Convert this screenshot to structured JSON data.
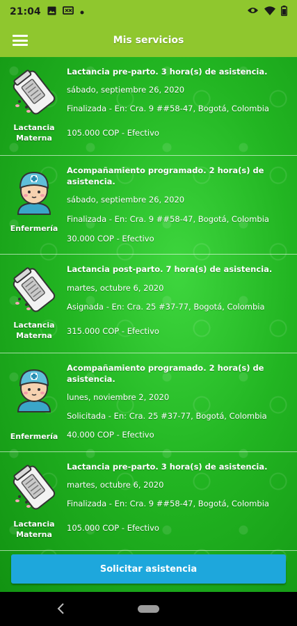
{
  "status_bar": {
    "time": "21:04",
    "left_icons": [
      "image-icon",
      "cast-icon",
      "dot-icon"
    ],
    "right_icons": [
      "eye-icon",
      "wifi-icon",
      "battery-icon"
    ]
  },
  "app_bar": {
    "title": "Mis servicios",
    "menu_icon": "menu-icon"
  },
  "services": [
    {
      "category": "Lactancia Materna",
      "icon": "breast-pump-icon",
      "service": "Lactancia pre-parto. 3 hora(s) de asistencia.",
      "date": "sábado, septiembre 26, 2020",
      "status_address": "Finalizada - En: Cra. 9 ##58-47, Bogotá, Colombia",
      "price_payment": "105.000 COP  - Efectivo"
    },
    {
      "category": "Enfermería",
      "icon": "nurse-icon",
      "service": "Acompañamiento programado. 2 hora(s) de asistencia.",
      "date": "sábado, septiembre 26, 2020",
      "status_address": "Finalizada - En: Cra. 9 ##58-47, Bogotá, Colombia",
      "price_payment": "30.000 COP  - Efectivo"
    },
    {
      "category": "Lactancia Materna",
      "icon": "breast-pump-icon",
      "service": "Lactancia post-parto. 7 hora(s) de asistencia.",
      "date": "martes, octubre 6, 2020",
      "status_address": "Asignada - En: Cra. 25 #37-77, Bogotá, Colombia",
      "price_payment": "315.000 COP  - Efectivo"
    },
    {
      "category": "Enfermería",
      "icon": "nurse-icon",
      "service": "Acompañamiento programado. 2 hora(s) de asistencia.",
      "date": "lunes, noviembre 2, 2020",
      "status_address": "Solicitada - En: Cra. 25 #37-77, Bogotá, Colombia",
      "price_payment": "40.000 COP  - Efectivo"
    },
    {
      "category": "Lactancia Materna",
      "icon": "breast-pump-icon",
      "service": "Lactancia pre-parto. 3 hora(s) de asistencia.",
      "date": "martes, octubre 6, 2020",
      "status_address": "Finalizada - En: Cra. 9 ##58-47, Bogotá, Colombia",
      "price_payment": "105.000 COP  - Efectivo"
    }
  ],
  "request_button": {
    "label": "Solicitar asistencia"
  },
  "colors": {
    "app_bar": "#8fc72e",
    "background": "#22b522",
    "button": "#1ea7dc"
  }
}
